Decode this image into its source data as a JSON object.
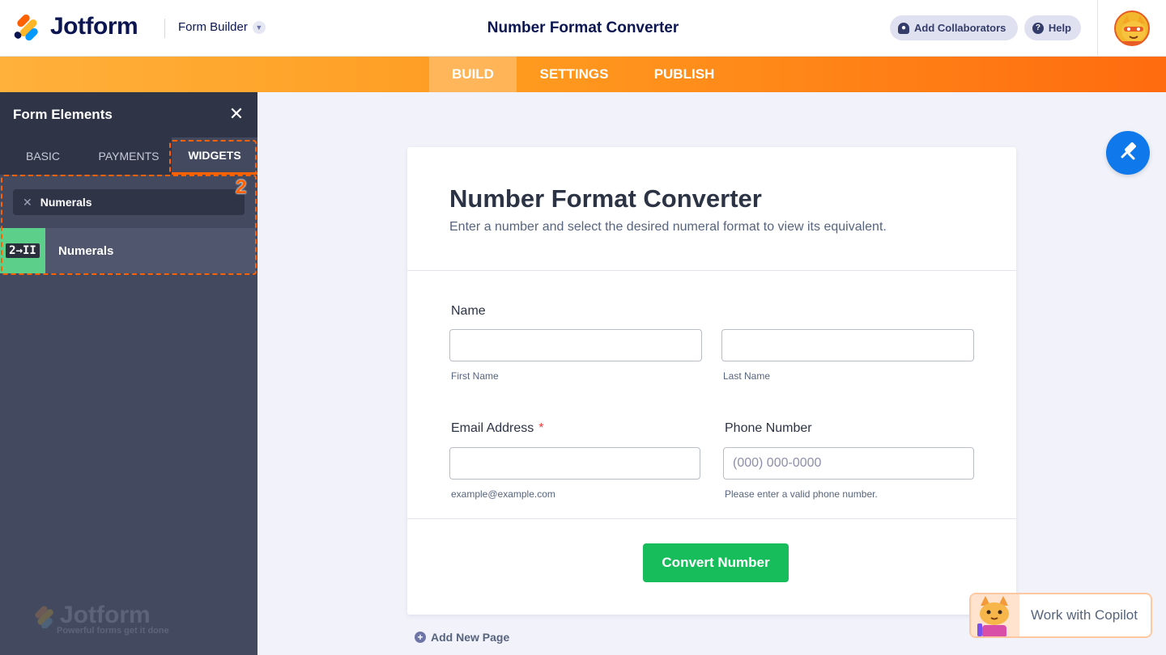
{
  "header": {
    "brand": "Jotform",
    "builder_menu": "Form Builder",
    "app_title": "Number Format Converter",
    "add_collaborators": "Add Collaborators",
    "help": "Help"
  },
  "nav": {
    "tabs": [
      {
        "label": "BUILD",
        "active": true
      },
      {
        "label": "SETTINGS",
        "active": false
      },
      {
        "label": "PUBLISH",
        "active": false
      }
    ]
  },
  "sidebar": {
    "title": "Form Elements",
    "tabs": [
      {
        "label": "BASIC",
        "active": false
      },
      {
        "label": "PAYMENTS",
        "active": false
      },
      {
        "label": "WIDGETS",
        "active": true
      }
    ],
    "search_value": "Numerals",
    "annotation_number": "2",
    "widget": {
      "icon_text": "2→II",
      "label": "Numerals"
    },
    "footer_brand": "Jotform",
    "footer_tagline": "Powerful forms get it done"
  },
  "form": {
    "title": "Number Format Converter",
    "subtitle": "Enter a number and select the desired numeral format to view its equivalent.",
    "name_label": "Name",
    "first_name_sublabel": "First Name",
    "last_name_sublabel": "Last Name",
    "email_label": "Email Address",
    "required_mark": "*",
    "email_sublabel": "example@example.com",
    "phone_label": "Phone Number",
    "phone_placeholder": "(000) 000-0000",
    "phone_sublabel": "Please enter a valid phone number.",
    "submit_label": "Convert Number"
  },
  "canvas": {
    "add_page": "Add New Page",
    "copilot_label": "Work with Copilot"
  },
  "colors": {
    "accent_orange": "#ff6100",
    "submit_green": "#18bd5b",
    "paint_blue": "#0f79ec",
    "sidebar_bg": "#434a60"
  }
}
